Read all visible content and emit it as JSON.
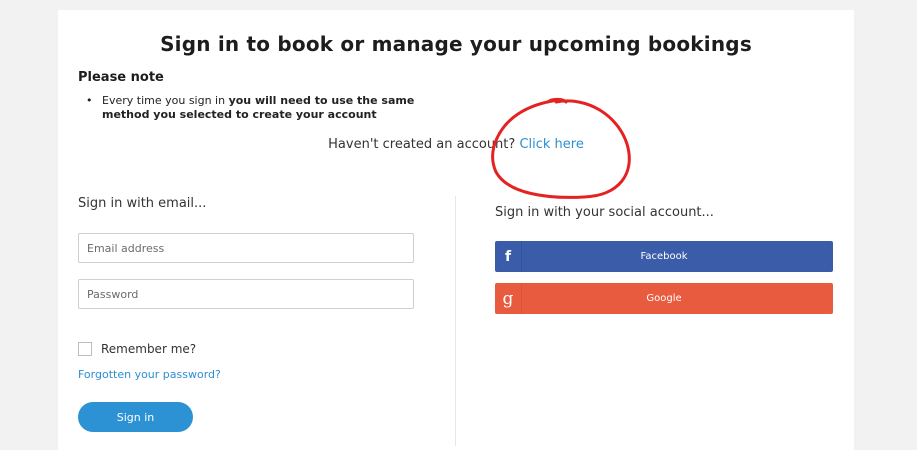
{
  "page": {
    "title": "Sign in to book or manage your upcoming bookings",
    "note_heading": "Please note",
    "note_prefix": "Every time you sign in ",
    "note_bold": "you will need to use the same method you selected to create your account",
    "create_prompt": "Haven't created an account? ",
    "create_link": "Click here"
  },
  "email_signin": {
    "heading": "Sign in with email...",
    "email_placeholder": "Email address",
    "password_placeholder": "Password",
    "remember_label": "Remember me?",
    "forgot_link": "Forgotten your password?",
    "signin_button": "Sign in"
  },
  "social_signin": {
    "heading": "Sign in with your social account...",
    "buttons": [
      {
        "label": "Facebook",
        "icon": "f",
        "color": "#3b5ca8"
      },
      {
        "label": "Google",
        "icon": "g",
        "color": "#e95b3e"
      }
    ]
  },
  "annotation": {
    "color": "#e52222"
  }
}
